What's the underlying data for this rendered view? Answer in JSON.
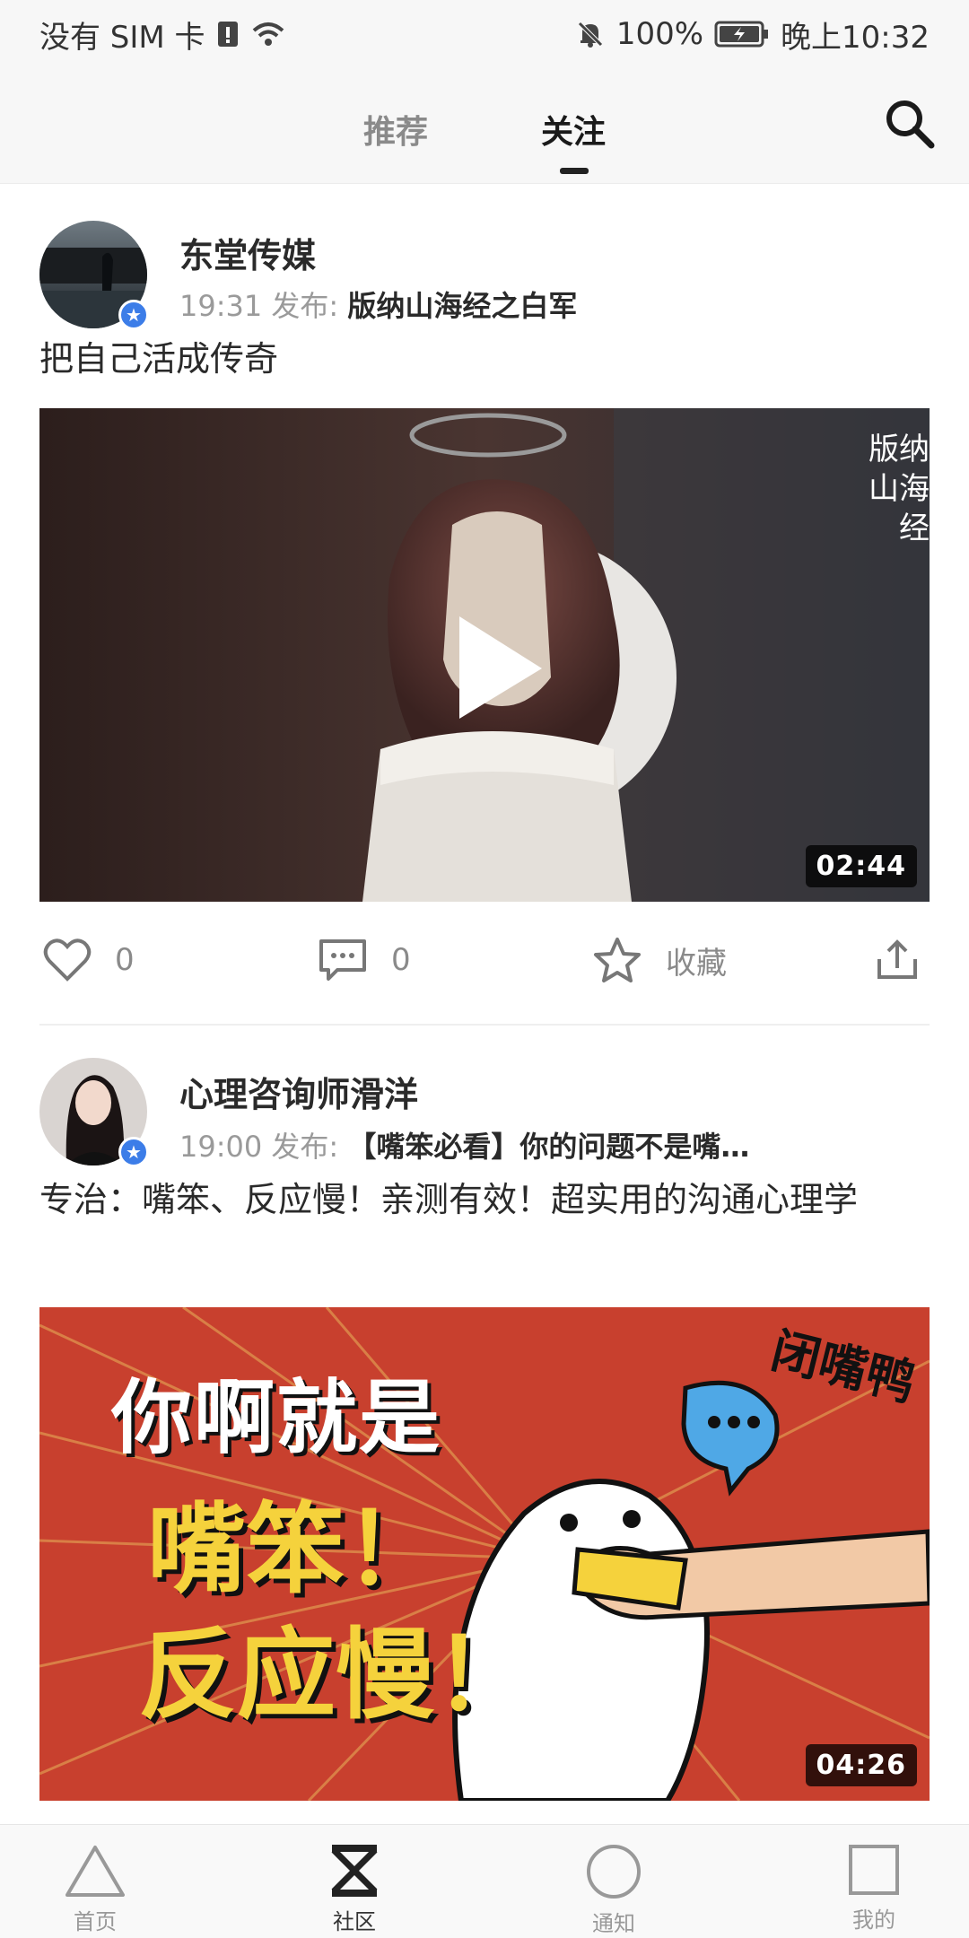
{
  "status_bar": {
    "carrier": "没有 SIM 卡",
    "battery": "100%",
    "time": "晚上10:32"
  },
  "top_nav": {
    "tabs": [
      {
        "label": "推荐",
        "active": false
      },
      {
        "label": "关注",
        "active": true
      }
    ]
  },
  "posts": [
    {
      "author": "东堂传媒",
      "time": "19:31 发布:",
      "video_title": "版纳山海经之白军",
      "description": "把自己活成传奇",
      "duration": "02:44",
      "overlay_text": "版纳 山海经",
      "likes": "0",
      "comments": "0",
      "favorite_label": "收藏"
    },
    {
      "author": "心理咨询师滑洋",
      "time": "19:00 发布:",
      "video_title": "【嘴笨必看】你的问题不是嘴…",
      "description": "专治：嘴笨、反应慢！亲测有效！超实用的沟通心理学",
      "duration": "04:26",
      "thumb_text": {
        "line1": "你啊就是",
        "line2": "嘴笨！",
        "line3": "反应慢！",
        "sticker": "闭嘴鸭"
      }
    }
  ],
  "bottom_nav": {
    "items": [
      {
        "label": "首页",
        "icon": "triangle-icon"
      },
      {
        "label": "社区",
        "icon": "community-x-icon",
        "active": true
      },
      {
        "label": "通知",
        "icon": "circle-icon"
      },
      {
        "label": "我的",
        "icon": "square-icon"
      }
    ]
  },
  "colors": {
    "accent": "#3c7de8",
    "thumb_red": "#c8402e",
    "thumb_yellow": "#f5d23c"
  }
}
